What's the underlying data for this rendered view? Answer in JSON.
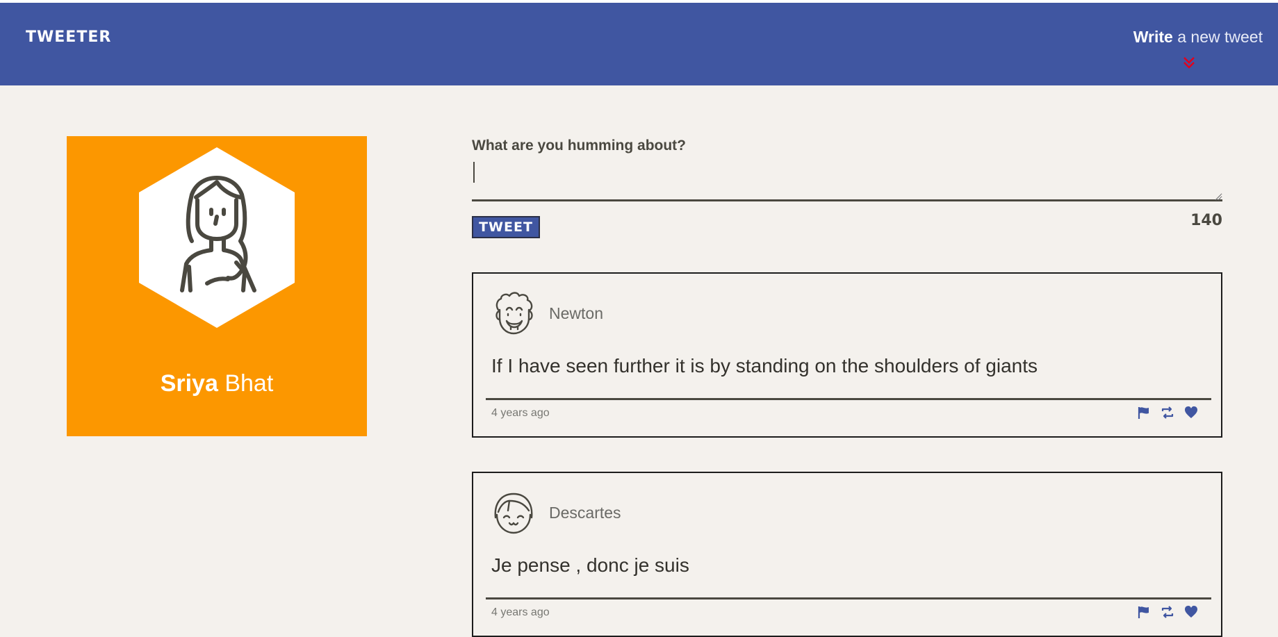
{
  "header": {
    "brand": "TWEETER",
    "write_bold": "Write",
    "write_rest": "a new tweet",
    "chevron_icon": "double-chevron-down-icon",
    "chevron_color": "#e3001b",
    "background": "#4056a1"
  },
  "profile": {
    "first_name": "Sriya",
    "last_name": "Bhat",
    "background": "#fc9700",
    "avatar_icon": "woman-avatar-icon"
  },
  "compose": {
    "label": "What are you humming about?",
    "value": "",
    "button_label": "TWEET",
    "counter": "140"
  },
  "tweets": [
    {
      "handle": "Newton",
      "avatar_icon": "curly-hair-man-avatar-icon",
      "text": "If I have seen further it is by standing on the shoulders of giants",
      "time": "4 years ago",
      "actions": [
        "flag-icon",
        "retweet-icon",
        "heart-icon"
      ]
    },
    {
      "handle": "Descartes",
      "avatar_icon": "bob-hair-avatar-icon",
      "text": "Je pense , donc je suis",
      "time": "4 years ago",
      "actions": [
        "flag-icon",
        "retweet-icon",
        "heart-icon"
      ]
    }
  ],
  "accent": "#4056a1"
}
